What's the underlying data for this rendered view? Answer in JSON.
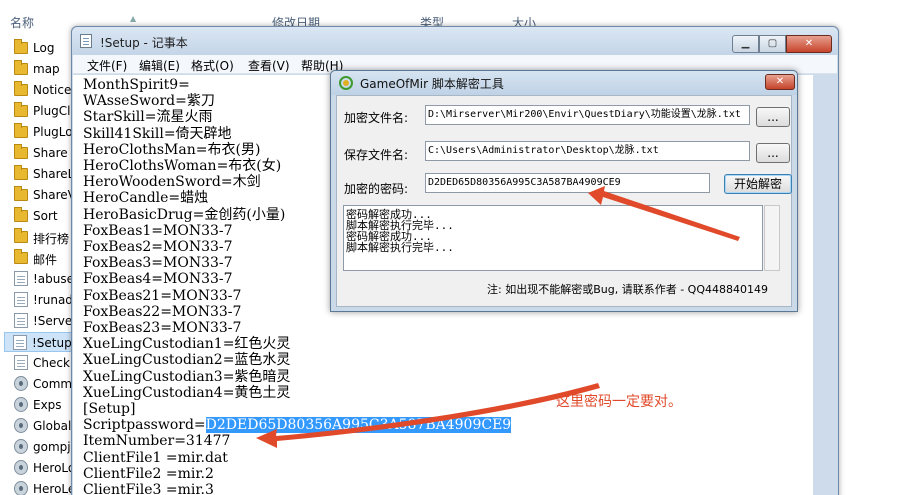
{
  "explorer": {
    "columns": {
      "name": "名称",
      "date": "修改日期",
      "type": "类型",
      "size": "大小"
    },
    "files": [
      {
        "name": "Log",
        "icon": "folder-icon"
      },
      {
        "name": "map",
        "icon": "folder-icon"
      },
      {
        "name": "Notice",
        "icon": "folder-icon"
      },
      {
        "name": "PlugCl",
        "icon": "folder-icon"
      },
      {
        "name": "PlugLo",
        "icon": "folder-icon"
      },
      {
        "name": "Share",
        "icon": "folder-icon"
      },
      {
        "name": "ShareL",
        "icon": "folder-icon"
      },
      {
        "name": "ShareV",
        "icon": "folder-icon"
      },
      {
        "name": "Sort",
        "icon": "folder-icon"
      },
      {
        "name": "排行榜",
        "icon": "folder-icon"
      },
      {
        "name": "邮件",
        "icon": "folder-icon"
      },
      {
        "name": "!abuse",
        "icon": "text-file-icon"
      },
      {
        "name": "!runad",
        "icon": "text-file-icon"
      },
      {
        "name": "!Server",
        "icon": "text-file-icon"
      },
      {
        "name": "!Setup",
        "icon": "text-file-icon",
        "selected": true
      },
      {
        "name": "Check",
        "icon": "text-file-icon"
      },
      {
        "name": "Comm",
        "icon": "settings-file-icon"
      },
      {
        "name": "Exps",
        "icon": "settings-file-icon"
      },
      {
        "name": "Global",
        "icon": "settings-file-icon"
      },
      {
        "name": "gompj",
        "icon": "settings-file-icon"
      },
      {
        "name": "HeroLo",
        "icon": "settings-file-icon"
      },
      {
        "name": "HeroLe",
        "icon": "settings-file-icon"
      }
    ]
  },
  "notepad": {
    "title": "!Setup - 记事本",
    "menu": {
      "file": "文件(F)",
      "edit": "编辑(E)",
      "format": "格式(O)",
      "view": "查看(V)",
      "help": "帮助(H)"
    },
    "lines": [
      "MonthSpirit9=",
      "WAsseSword=紫刀",
      "StarSkill=流星火雨",
      "Skill41Skill=倚天辟地",
      "HeroClothsMan=布衣(男)",
      "HeroClothsWoman=布衣(女)",
      "HeroWoodenSword=木剑",
      "HeroCandle=蜡烛",
      "HeroBasicDrug=金创药(小量)",
      "FoxBeas1=MON33-7",
      "FoxBeas2=MON33-7",
      "FoxBeas3=MON33-7",
      "FoxBeas4=MON33-7",
      "FoxBeas21=MON33-7",
      "FoxBeas22=MON33-7",
      "FoxBeas23=MON33-7",
      "XueLingCustodian1=红色火灵",
      "XueLingCustodian2=蓝色水灵",
      "XueLingCustodian3=紫色暗灵",
      "XueLingCustodian4=黄色土灵",
      "[Setup]"
    ],
    "password_key": "Scriptpassword=",
    "password_value": "D2DED65D80356A995C3A587BA4909CE9",
    "lines_after": [
      "ItemNumber=31477",
      "ClientFile1 =mir.dat",
      "ClientFile2 =mir.2",
      "ClientFile3 =mir.3"
    ]
  },
  "dialog": {
    "title": "GameOfMir 脚本解密工具",
    "encrypted_file_label": "加密文件名:",
    "encrypted_file_value": "D:\\Mirserver\\Mir200\\Envir\\QuestDiary\\功能设置\\龙脉.txt",
    "save_file_label": "保存文件名:",
    "save_file_value": "C:\\Users\\Administrator\\Desktop\\龙脉.txt",
    "browse_label": "...",
    "password_label": "加密的密码:",
    "password_value": "D2DED65D80356A995C3A587BA4909CE9",
    "decrypt_button": "开始解密",
    "log": "密码解密成功...\n脚本解密执行完毕...\n密码解密成功...\n脚本解密执行完毕...",
    "note": "注: 如出现不能解密或Bug, 请联系作者 - QQ448840149"
  },
  "annotation": {
    "text": "这里密码一定要对。",
    "color": "#e04a2a"
  }
}
